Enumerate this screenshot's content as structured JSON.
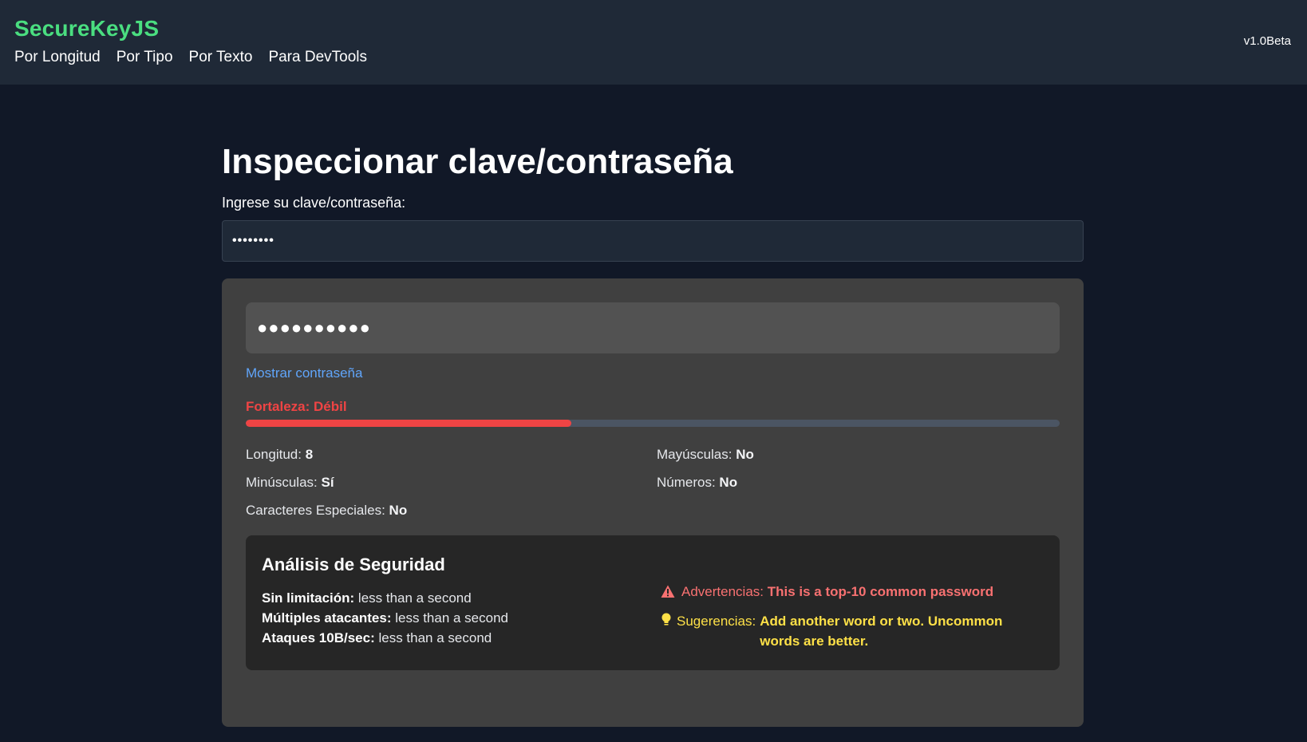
{
  "header": {
    "brand": "SecureKeyJS",
    "nav": [
      "Por Longitud",
      "Por Tipo",
      "Por Texto",
      "Para DevTools"
    ],
    "version": "v1.0Beta"
  },
  "main": {
    "title": "Inspeccionar clave/contraseña",
    "input_label": "Ingrese su clave/contraseña:",
    "input_value": "••••••••"
  },
  "result": {
    "masked_display": "●●●●●●●●●●",
    "show_link": "Mostrar contraseña",
    "strength_label": "Fortaleza: Débil",
    "strength_percent": 40,
    "strength_color": "#ef4444",
    "stats": [
      {
        "label": "Longitud:",
        "value": "8"
      },
      {
        "label": "Mayúsculas:",
        "value": "No"
      },
      {
        "label": "Minúsculas:",
        "value": "Sí"
      },
      {
        "label": "Números:",
        "value": "No"
      },
      {
        "label": "Caracteres Especiales:",
        "value": "No"
      }
    ]
  },
  "analysis": {
    "title": "Análisis de Seguridad",
    "crack_times": [
      {
        "label": "Sin limitación:",
        "value": "less than a second"
      },
      {
        "label": "Múltiples atacantes:",
        "value": "less than a second"
      },
      {
        "label": "Ataques 10B/sec:",
        "value": "less than a second"
      }
    ],
    "warning_label": "Advertencias:",
    "warning_text": "This is a top-10 common password",
    "warning_icon": "warning-triangle-icon",
    "suggestion_label": "Sugerencias:",
    "suggestion_text": "Add another word or two. Uncommon words are better.",
    "suggestion_icon": "lightbulb-icon"
  }
}
